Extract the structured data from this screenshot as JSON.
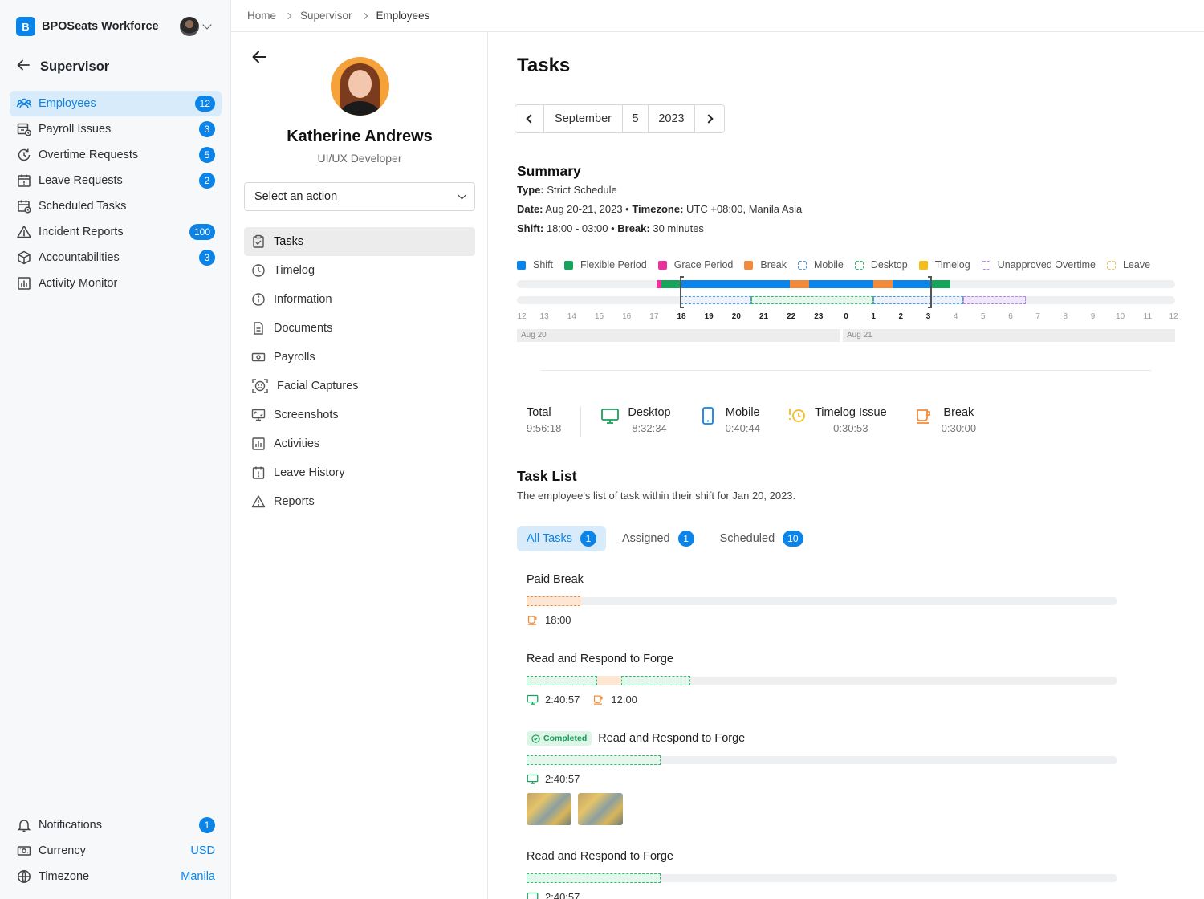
{
  "app": {
    "brand_letter": "B",
    "brand_name": "BPOSeats Workforce"
  },
  "breadcrumb": [
    "Home",
    "Supervisor",
    "Employees"
  ],
  "sidebar": {
    "back_label": "Supervisor",
    "items": [
      {
        "label": "Employees",
        "badge": "12",
        "icon": "users-icon",
        "active": true
      },
      {
        "label": "Payroll Issues",
        "badge": "3",
        "icon": "payroll-icon"
      },
      {
        "label": "Overtime Requests",
        "badge": "5",
        "icon": "clock-rotate-icon"
      },
      {
        "label": "Leave Requests",
        "badge": "2",
        "icon": "calendar-icon"
      },
      {
        "label": "Scheduled Tasks",
        "badge": "",
        "icon": "calendar-clock-icon"
      },
      {
        "label": "Incident Reports",
        "badge": "100",
        "icon": "warning-icon"
      },
      {
        "label": "Accountabilities",
        "badge": "3",
        "icon": "box-icon"
      },
      {
        "label": "Activity Monitor",
        "badge": "",
        "icon": "bar-chart-icon"
      }
    ],
    "bottom": {
      "notifications_label": "Notifications",
      "notifications_badge": "1",
      "currency_label": "Currency",
      "currency_value": "USD",
      "timezone_label": "Timezone",
      "timezone_value": "Manila"
    }
  },
  "profile": {
    "name": "Katherine Andrews",
    "role": "UI/UX Developer",
    "action_placeholder": "Select an action",
    "menu": [
      {
        "label": "Tasks",
        "icon": "clipboard-check-icon",
        "active": true
      },
      {
        "label": "Timelog",
        "icon": "clock-icon"
      },
      {
        "label": "Information",
        "icon": "info-icon"
      },
      {
        "label": "Documents",
        "icon": "document-icon"
      },
      {
        "label": "Payrolls",
        "icon": "money-icon"
      },
      {
        "label": "Facial Captures",
        "icon": "face-scan-icon"
      },
      {
        "label": "Screenshots",
        "icon": "screenshot-icon"
      },
      {
        "label": "Activities",
        "icon": "bar-chart-icon"
      },
      {
        "label": "Leave History",
        "icon": "calendar-icon"
      },
      {
        "label": "Reports",
        "icon": "warning-icon"
      }
    ]
  },
  "main": {
    "title": "Tasks",
    "date": {
      "month": "September",
      "day": "5",
      "year": "2023"
    },
    "summary": {
      "title": "Summary",
      "type_label": "Type:",
      "type_value": "Strict Schedule",
      "date_label": "Date:",
      "date_value": "Aug 20-21, 2023",
      "timezone_label": "Timezone:",
      "timezone_value": "UTC +08:00, Manila Asia",
      "shift_label": "Shift:",
      "shift_value": "18:00 - 03:00",
      "break_label": "Break:",
      "break_value": "30 minutes"
    },
    "legend": [
      {
        "label": "Shift",
        "color": "#0a84e8",
        "dashed": false
      },
      {
        "label": "Flexible Period",
        "color": "#16a35a",
        "dashed": false
      },
      {
        "label": "Grace Period",
        "color": "#e8339d",
        "dashed": false
      },
      {
        "label": "Break",
        "color": "#f08a3c",
        "dashed": false
      },
      {
        "label": "Mobile",
        "color": "#4a9de8",
        "dashed": true
      },
      {
        "label": "Desktop",
        "color": "#2fbf73",
        "dashed": true
      },
      {
        "label": "Timelog",
        "color": "#f2bd1d",
        "dashed": false
      },
      {
        "label": "Unapproved Overtime",
        "color": "#b98be8",
        "dashed": true
      },
      {
        "label": "Leave",
        "color": "#f4c26b",
        "dashed": true
      }
    ],
    "timeline_hours": [
      "12",
      "13",
      "14",
      "15",
      "16",
      "17",
      "18",
      "19",
      "20",
      "21",
      "22",
      "23",
      "0",
      "1",
      "2",
      "3",
      "4",
      "5",
      "6",
      "7",
      "8",
      "9",
      "10",
      "11",
      "12"
    ],
    "timeline_days": [
      "Aug 20",
      "Aug 21"
    ],
    "stats": {
      "total_label": "Total",
      "total_value": "9:56:18",
      "desktop_label": "Desktop",
      "desktop_value": "8:32:34",
      "mobile_label": "Mobile",
      "mobile_value": "0:40:44",
      "timelog_label": "Timelog Issue",
      "timelog_value": "0:30:53",
      "break_label": "Break",
      "break_value": "0:30:00"
    },
    "task_list": {
      "title": "Task List",
      "description": "The employee's list of task within their shift for Jan 20, 2023.",
      "tabs": [
        {
          "label": "All Tasks",
          "count": "1",
          "active": true
        },
        {
          "label": "Assigned",
          "count": "1"
        },
        {
          "label": "Scheduled",
          "count": "10"
        }
      ],
      "tasks": [
        {
          "name": "Paid Break",
          "break_time": "18:00"
        },
        {
          "name": "Read and Respond to Forge",
          "desktop_time": "2:40:57",
          "break_time": "12:00"
        },
        {
          "name": "Read and Respond to Forge",
          "status": "Completed",
          "desktop_time": "2:40:57"
        },
        {
          "name": "Read and Respond to Forge",
          "desktop_time": "2:40:57"
        }
      ]
    }
  }
}
